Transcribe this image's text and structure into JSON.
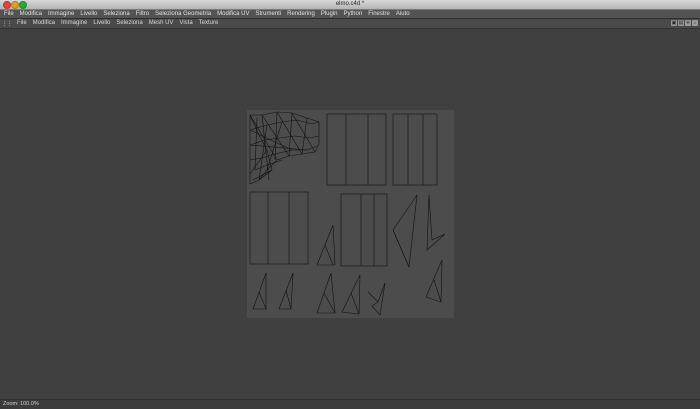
{
  "window": {
    "title": "elmo.c4d *"
  },
  "menubar": {
    "items": [
      "File",
      "Modifica",
      "Immagine",
      "Livello",
      "Seleziona",
      "Filtro",
      "Seleziona Geometria",
      "Modifica UV",
      "Strumenti",
      "Rendering",
      "Plugin",
      "Python",
      "Finestre",
      "Aiuto"
    ]
  },
  "uv_menubar": {
    "items": [
      "File",
      "Modifica",
      "Immagine",
      "Livello",
      "Seleziona",
      "Mesh UV",
      "Vista",
      "Texture"
    ]
  },
  "nav_icons": [
    "layout-icon",
    "lock-icon",
    "move-icon",
    "zoom-icon"
  ],
  "status": {
    "zoom_text": "Zoom: 100.0%"
  },
  "colors": {
    "background": "#404040",
    "uv_canvas": "#4c4c4c",
    "wire": "#101010"
  }
}
